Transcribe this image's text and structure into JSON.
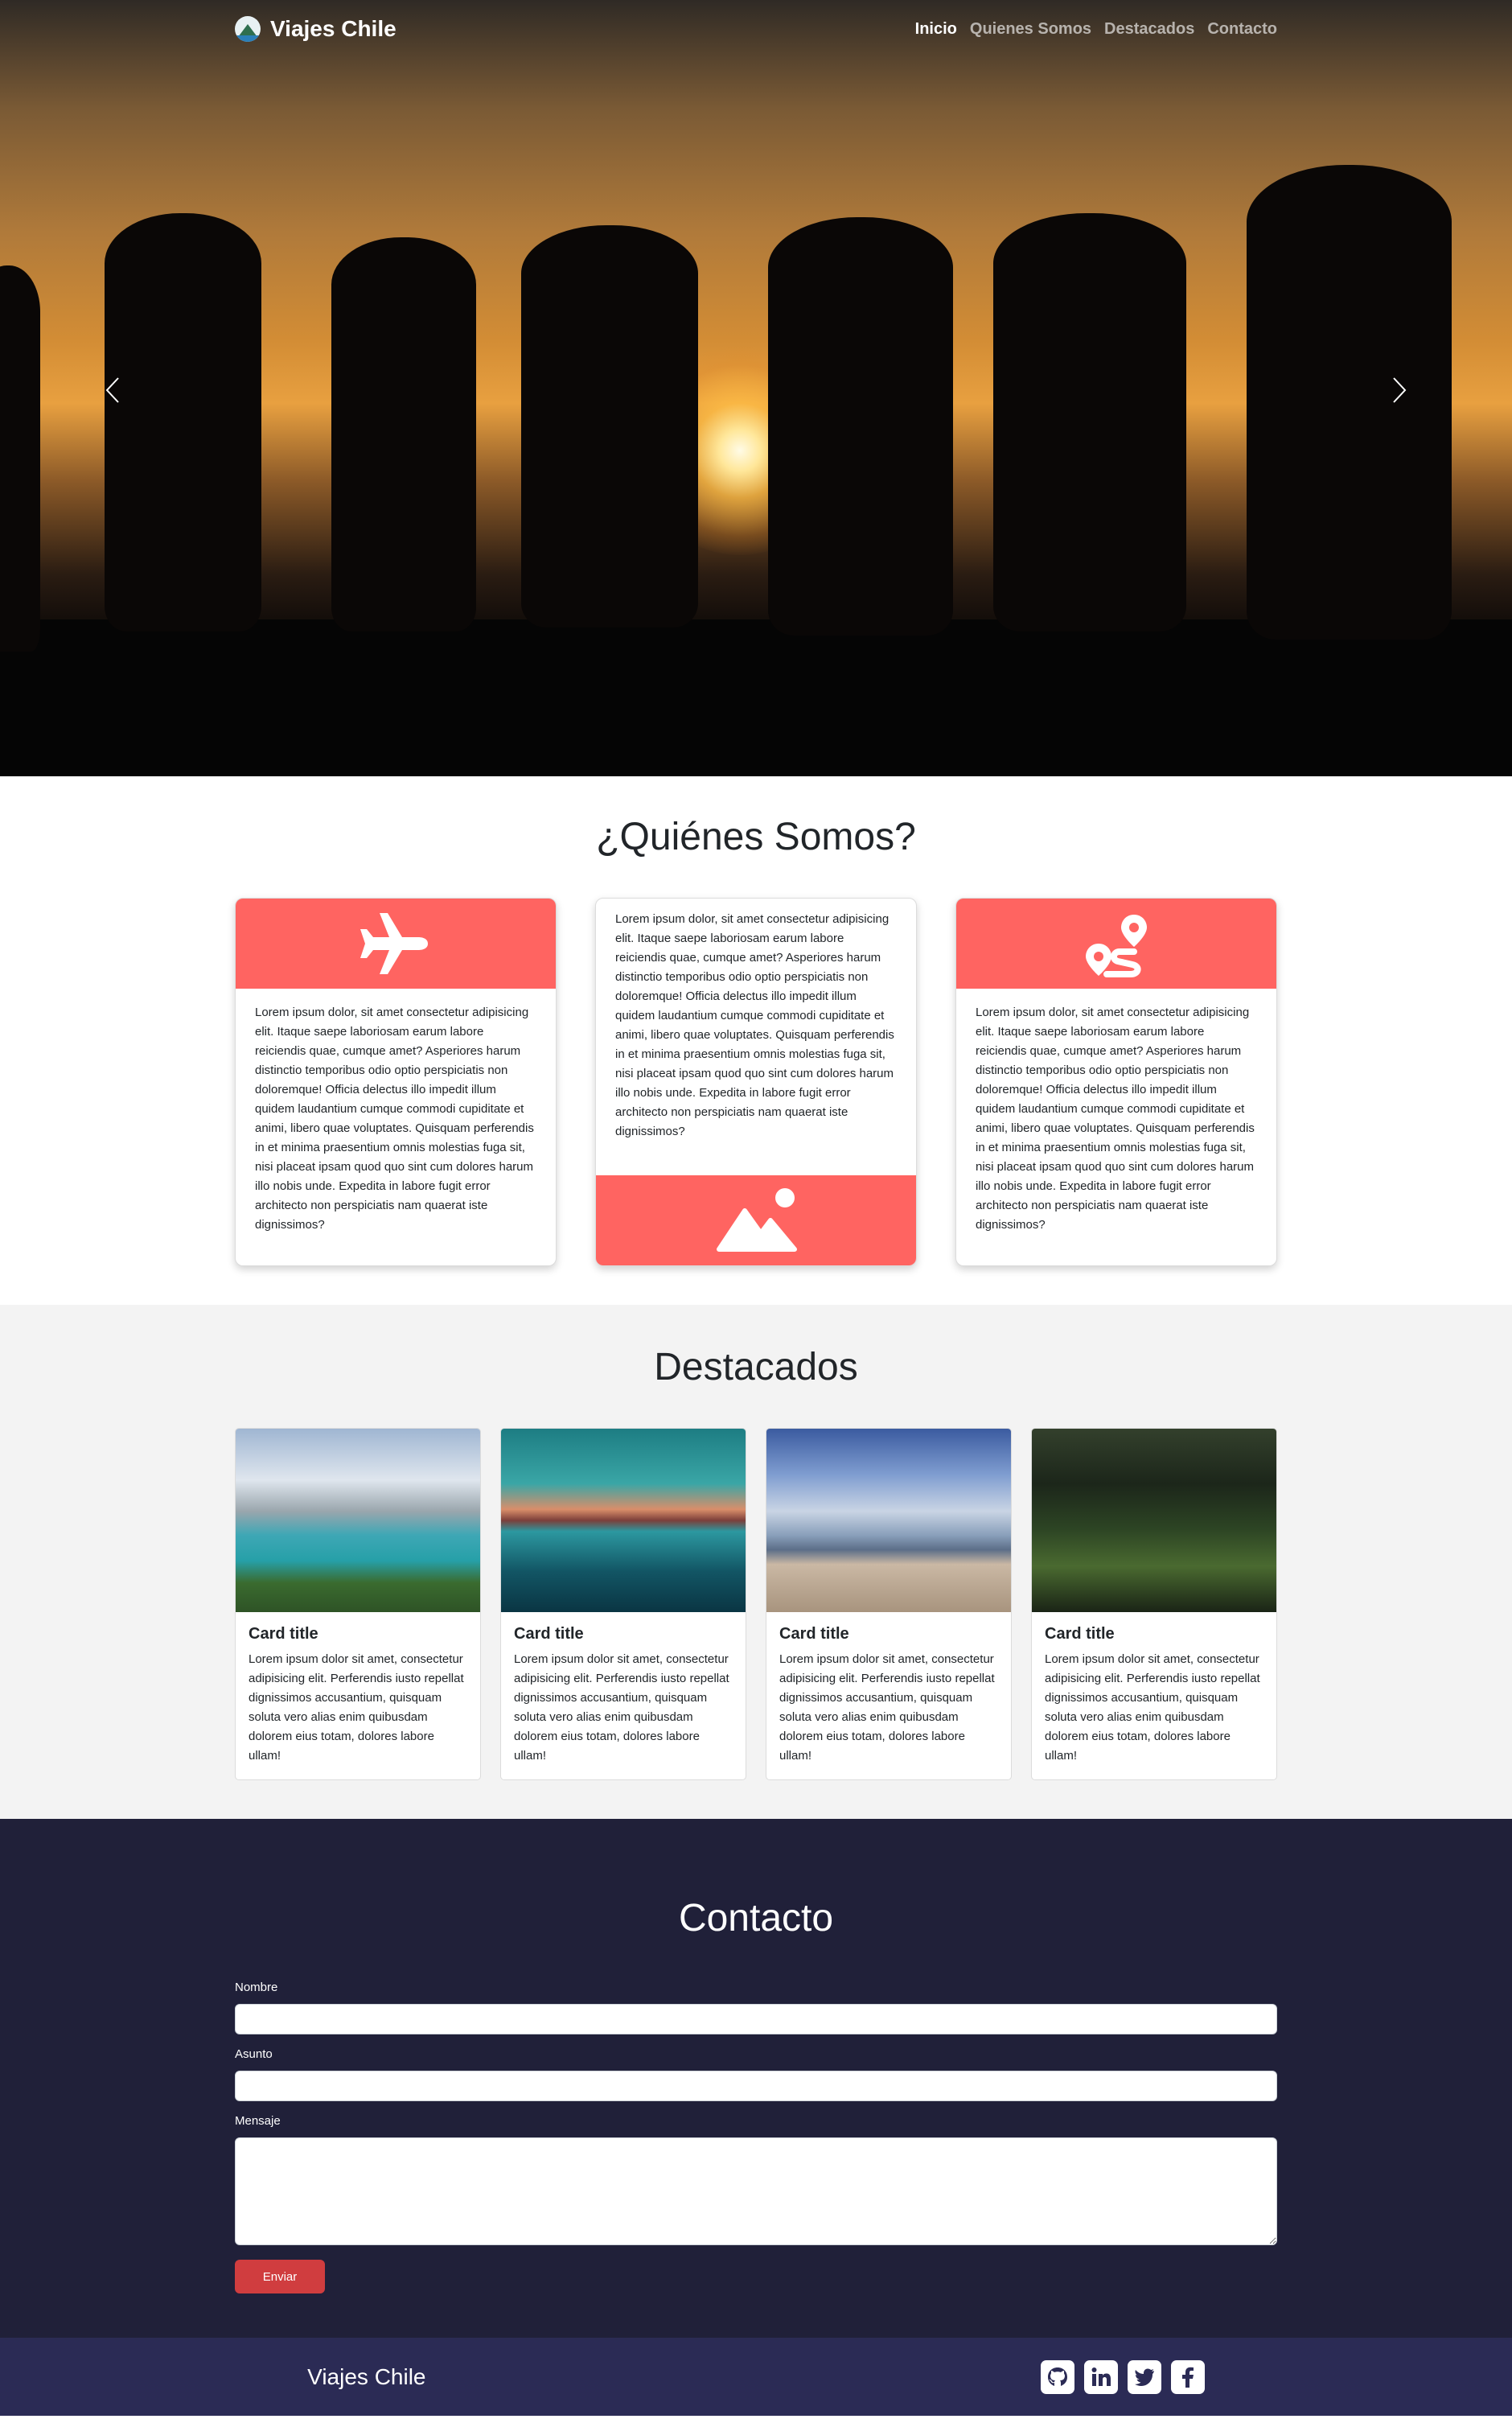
{
  "nav": {
    "brand": "Viajes Chile",
    "links": [
      {
        "label": "Inicio",
        "active": true
      },
      {
        "label": "Quienes Somos",
        "active": false
      },
      {
        "label": "Destacados",
        "active": false
      },
      {
        "label": "Contacto",
        "active": false
      }
    ]
  },
  "hero": {
    "prev_icon": "chevron-left-icon",
    "next_icon": "chevron-right-icon"
  },
  "quienes": {
    "title": "¿Quiénes Somos?",
    "cards": [
      {
        "icon": "plane-icon",
        "text": "Lorem ipsum dolor, sit amet consectetur adipisicing elit. Itaque saepe laboriosam earum labore reiciendis quae, cumque amet? Asperiores harum distinctio temporibus odio optio perspiciatis non doloremque! Officia delectus illo impedit illum quidem laudantium cumque commodi cupiditate et animi, libero quae voluptates. Quisquam perferendis in et minima praesentium omnis molestias fuga sit, nisi placeat ipsam quod quo sint cum dolores harum illo nobis unde. Expedita in labore fugit error architecto non perspiciatis nam quaerat iste dignissimos?"
      },
      {
        "icon": "image-icon",
        "text": "Lorem ipsum dolor, sit amet consectetur adipisicing elit. Itaque saepe laboriosam earum labore reiciendis quae, cumque amet? Asperiores harum distinctio temporibus odio optio perspiciatis non doloremque! Officia delectus illo impedit illum quidem laudantium cumque commodi cupiditate et animi, libero quae voluptates. Quisquam perferendis in et minima praesentium omnis molestias fuga sit, nisi placeat ipsam quod quo sint cum dolores harum illo nobis unde. Expedita in labore fugit error architecto non perspiciatis nam quaerat iste dignissimos?"
      },
      {
        "icon": "route-icon",
        "text": "Lorem ipsum dolor, sit amet consectetur adipisicing elit. Itaque saepe laboriosam earum labore reiciendis quae, cumque amet? Asperiores harum distinctio temporibus odio optio perspiciatis non doloremque! Officia delectus illo impedit illum quidem laudantium cumque commodi cupiditate et animi, libero quae voluptates. Quisquam perferendis in et minima praesentium omnis molestias fuga sit, nisi placeat ipsam quod quo sint cum dolores harum illo nobis unde. Expedita in labore fugit error architecto non perspiciatis nam quaerat iste dignissimos?"
      }
    ]
  },
  "destacados": {
    "title": "Destacados",
    "cards": [
      {
        "title": "Card title",
        "text": "Lorem ipsum dolor sit amet, consectetur adipisicing elit. Perferendis iusto repellat dignissimos accusantium, quisquam soluta vero alias enim quibusdam dolorem eius totam, dolores labore ullam!"
      },
      {
        "title": "Card title",
        "text": "Lorem ipsum dolor sit amet, consectetur adipisicing elit. Perferendis iusto repellat dignissimos accusantium, quisquam soluta vero alias enim quibusdam dolorem eius totam, dolores labore ullam!"
      },
      {
        "title": "Card title",
        "text": "Lorem ipsum dolor sit amet, consectetur adipisicing elit. Perferendis iusto repellat dignissimos accusantium, quisquam soluta vero alias enim quibusdam dolorem eius totam, dolores labore ullam!"
      },
      {
        "title": "Card title",
        "text": "Lorem ipsum dolor sit amet, consectetur adipisicing elit. Perferendis iusto repellat dignissimos accusantium, quisquam soluta vero alias enim quibusdam dolorem eius totam, dolores labore ullam!"
      }
    ]
  },
  "contacto": {
    "title": "Contacto",
    "fields": {
      "nombre_label": "Nombre",
      "nombre_value": "",
      "asunto_label": "Asunto",
      "asunto_value": "",
      "mensaje_label": "Mensaje",
      "mensaje_value": ""
    },
    "submit": "Enviar"
  },
  "footer": {
    "brand": "Viajes Chile",
    "socials": [
      "github-icon",
      "linkedin-icon",
      "twitter-icon",
      "facebook-icon"
    ]
  },
  "colors": {
    "accent": "#ff6461",
    "contact_bg": "#202039",
    "footer_bg": "#2b2b55",
    "button": "#d03d3f"
  }
}
